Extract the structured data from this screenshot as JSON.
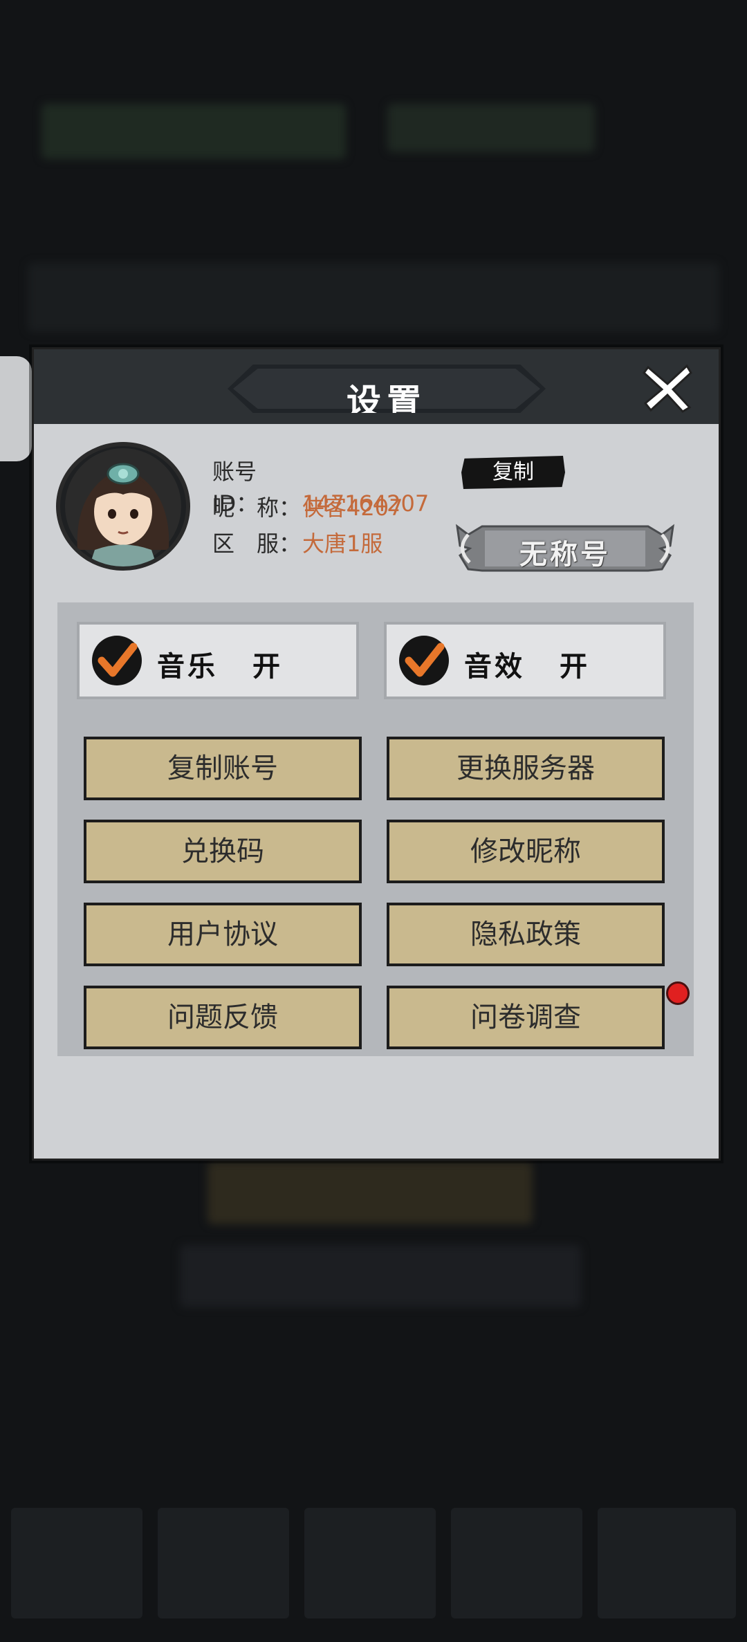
{
  "dialog": {
    "title": "设置",
    "close_icon": "close-x-icon"
  },
  "profile": {
    "account_id_label": "账号ID：",
    "account_id_value": "147164207",
    "nickname_label": "昵　称：",
    "nickname_value": "侠客4207",
    "server_label": "区　服：",
    "server_value": "大唐1服",
    "copy_button": "复制",
    "title_badge": "无称号",
    "avatar_icon": "character-portrait"
  },
  "toggles": [
    {
      "label": "音乐",
      "state": "开",
      "checked": true
    },
    {
      "label": "音效",
      "state": "开",
      "checked": true
    }
  ],
  "buttons": [
    {
      "label": "复制账号"
    },
    {
      "label": "更换服务器"
    },
    {
      "label": "兑换码"
    },
    {
      "label": "修改昵称"
    },
    {
      "label": "用户协议"
    },
    {
      "label": "隐私政策"
    },
    {
      "label": "问题反馈"
    },
    {
      "label": "问卷调查",
      "notification": true
    }
  ],
  "colors": {
    "accent_value": "#c46a3b",
    "button_bg": "#c9b98e",
    "notify_dot": "#e02020",
    "check_orange": "#e8772a"
  }
}
